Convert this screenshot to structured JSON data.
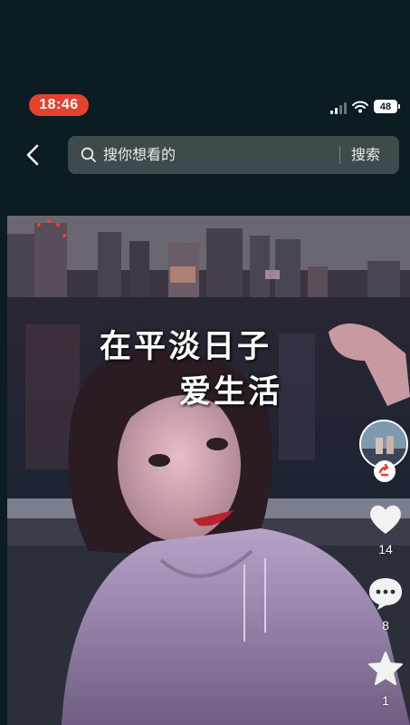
{
  "status_bar": {
    "time": "18:46",
    "battery": "48",
    "time_pill_color": "#e6412e"
  },
  "header": {
    "back_icon": "chevron-left-icon",
    "search": {
      "placeholder": "搜你想看的",
      "submit_label": "搜索",
      "icon": "search-icon"
    }
  },
  "video": {
    "caption_lines": [
      "在平淡日子",
      "爱生活"
    ]
  },
  "actions": {
    "creator_avatar": "avatar",
    "follow_icon": "follow-plus-icon",
    "like": {
      "icon": "heart-icon",
      "count": "14"
    },
    "comment": {
      "icon": "comment-icon",
      "count": "8"
    },
    "favorite": {
      "icon": "star-icon",
      "count": "1"
    }
  }
}
